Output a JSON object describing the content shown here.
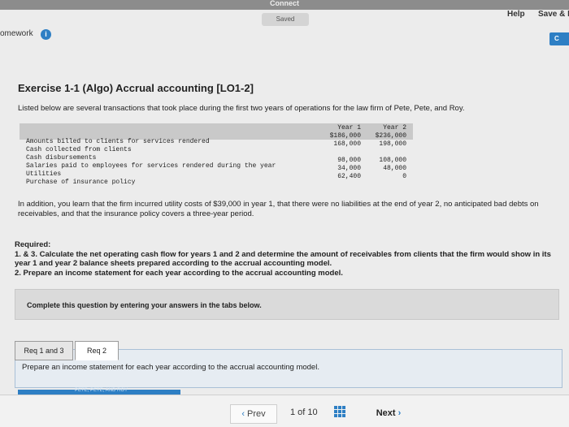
{
  "window": {
    "title": "Connect",
    "saved": "Saved",
    "help": "Help",
    "save_exit": "Save & E",
    "homework": "omework",
    "corner_btn": "C"
  },
  "exercise": {
    "title": "Exercise 1-1 (Algo) Accrual accounting [LO1-2]",
    "intro": "Listed below are several transactions that took place during the first two years of operations for the law firm of Pete, Pete, and Roy.",
    "table": {
      "headers": [
        "Year 1",
        "Year 2"
      ],
      "rows": [
        {
          "label": "Amounts billed to clients for services rendered",
          "y1": "$186,000",
          "y2": "$236,000"
        },
        {
          "label": "Cash collected from clients",
          "y1": "168,000",
          "y2": "198,000"
        },
        {
          "label": "Cash disbursements",
          "y1": "",
          "y2": ""
        },
        {
          "label": "Salaries paid to employees for services rendered during the year",
          "y1": "98,000",
          "y2": "108,000"
        },
        {
          "label": "Utilities",
          "y1": "34,000",
          "y2": "48,000"
        },
        {
          "label": "Purchase of insurance policy",
          "y1": "62,400",
          "y2": "0"
        }
      ]
    },
    "paragraph": "In addition, you learn that the firm incurred utility costs of $39,000 in year 1, that there were no liabilities at the end of year 2, no anticipated bad debts on receivables, and that the insurance policy covers a three-year period.",
    "required_label": "Required:",
    "req1": "1. & 3. Calculate the net operating cash flow for years 1 and 2 and determine the amount of receivables from clients that the firm would show in its year 1 and year 2 balance sheets prepared according to the accrual accounting model.",
    "req2": "2. Prepare an income statement for each year according to the accrual accounting model."
  },
  "complete_box": "Complete this question by entering your answers in the tabs below.",
  "tabs": [
    {
      "label": "Req 1 and 3"
    },
    {
      "label": "Req 2"
    }
  ],
  "tab_panel_text": "Prepare an income statement for each year according to the accrual accounting model.",
  "bluebar_text": "PETE, PETE, AND ROY",
  "footer": {
    "prev": "Prev",
    "page": "1 of 10",
    "next": "Next"
  },
  "colors": {
    "accent": "#2e7fc4"
  }
}
